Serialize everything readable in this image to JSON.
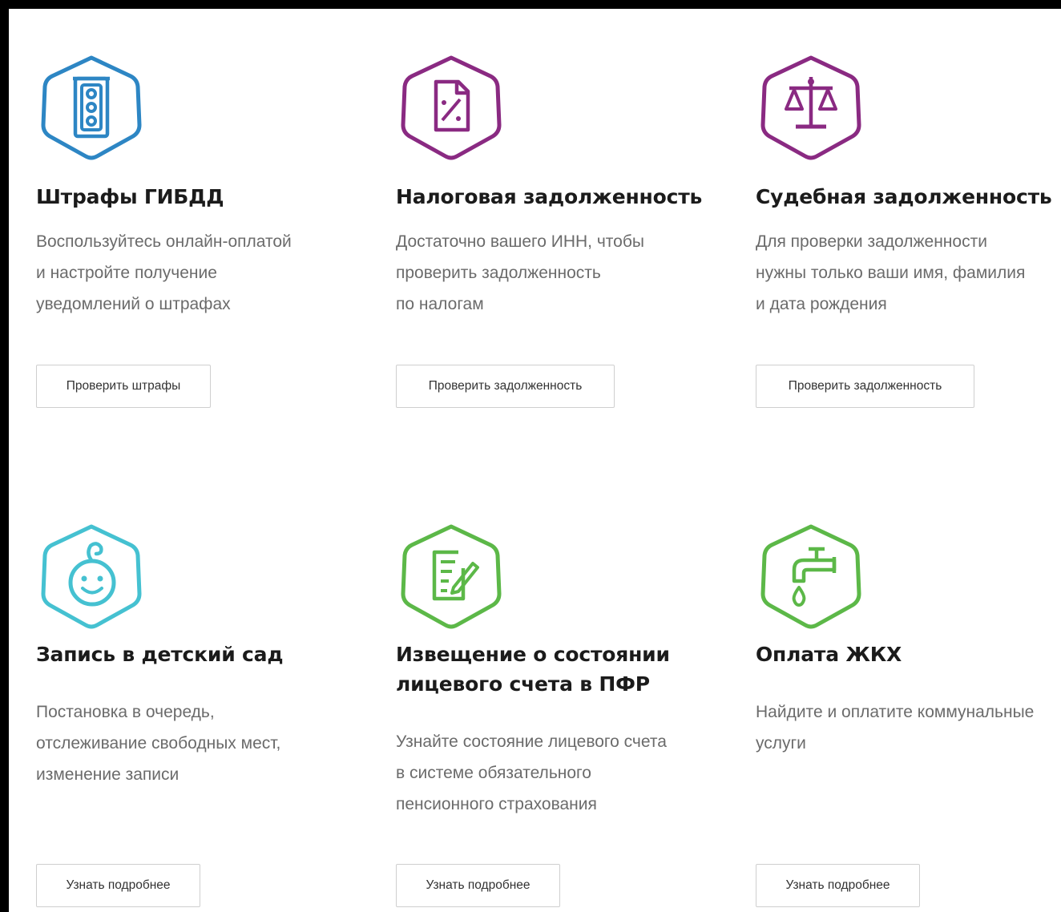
{
  "colors": {
    "blue": "#2d86c4",
    "purple": "#8a2a82",
    "teal": "#45c1d1",
    "green": "#5cb848"
  },
  "cards": [
    {
      "icon": "traffic-light-icon",
      "title_lines": [
        "Штрафы ГИБДД"
      ],
      "desc_lines": [
        "Воспользуйтесь онлайн-оплатой",
        "и настройте получение",
        "уведомлений о штрафах"
      ],
      "button": "Проверить штрафы"
    },
    {
      "icon": "tax-document-icon",
      "title_lines": [
        "Налоговая задолженность"
      ],
      "desc_lines": [
        "Достаточно вашего ИНН, чтобы",
        "проверить задолженность",
        "по налогам"
      ],
      "button": "Проверить задолженность"
    },
    {
      "icon": "scales-icon",
      "title_lines": [
        "Судебная задолженность"
      ],
      "desc_lines": [
        "Для проверки задолженности",
        "нужны только ваши имя, фамилия",
        "и дата рождения"
      ],
      "button": "Проверить задолженность"
    },
    {
      "icon": "baby-face-icon",
      "title_lines": [
        "Запись в детский сад"
      ],
      "desc_lines": [
        "Постановка в очередь,",
        "отслеживание свободных мест,",
        "изменение записи"
      ],
      "button": "Узнать подробнее"
    },
    {
      "icon": "document-edit-icon",
      "title_lines": [
        "Извещение о состоянии",
        "лицевого счета в ПФР"
      ],
      "desc_lines": [
        "Узнайте состояние лицевого счета",
        "в системе обязательного",
        "пенсионного страхования"
      ],
      "button": "Узнать подробнее"
    },
    {
      "icon": "water-tap-icon",
      "title_lines": [
        "Оплата ЖКХ"
      ],
      "desc_lines": [
        "Найдите и оплатите коммунальные",
        "услуги"
      ],
      "button": "Узнать подробнее"
    }
  ]
}
